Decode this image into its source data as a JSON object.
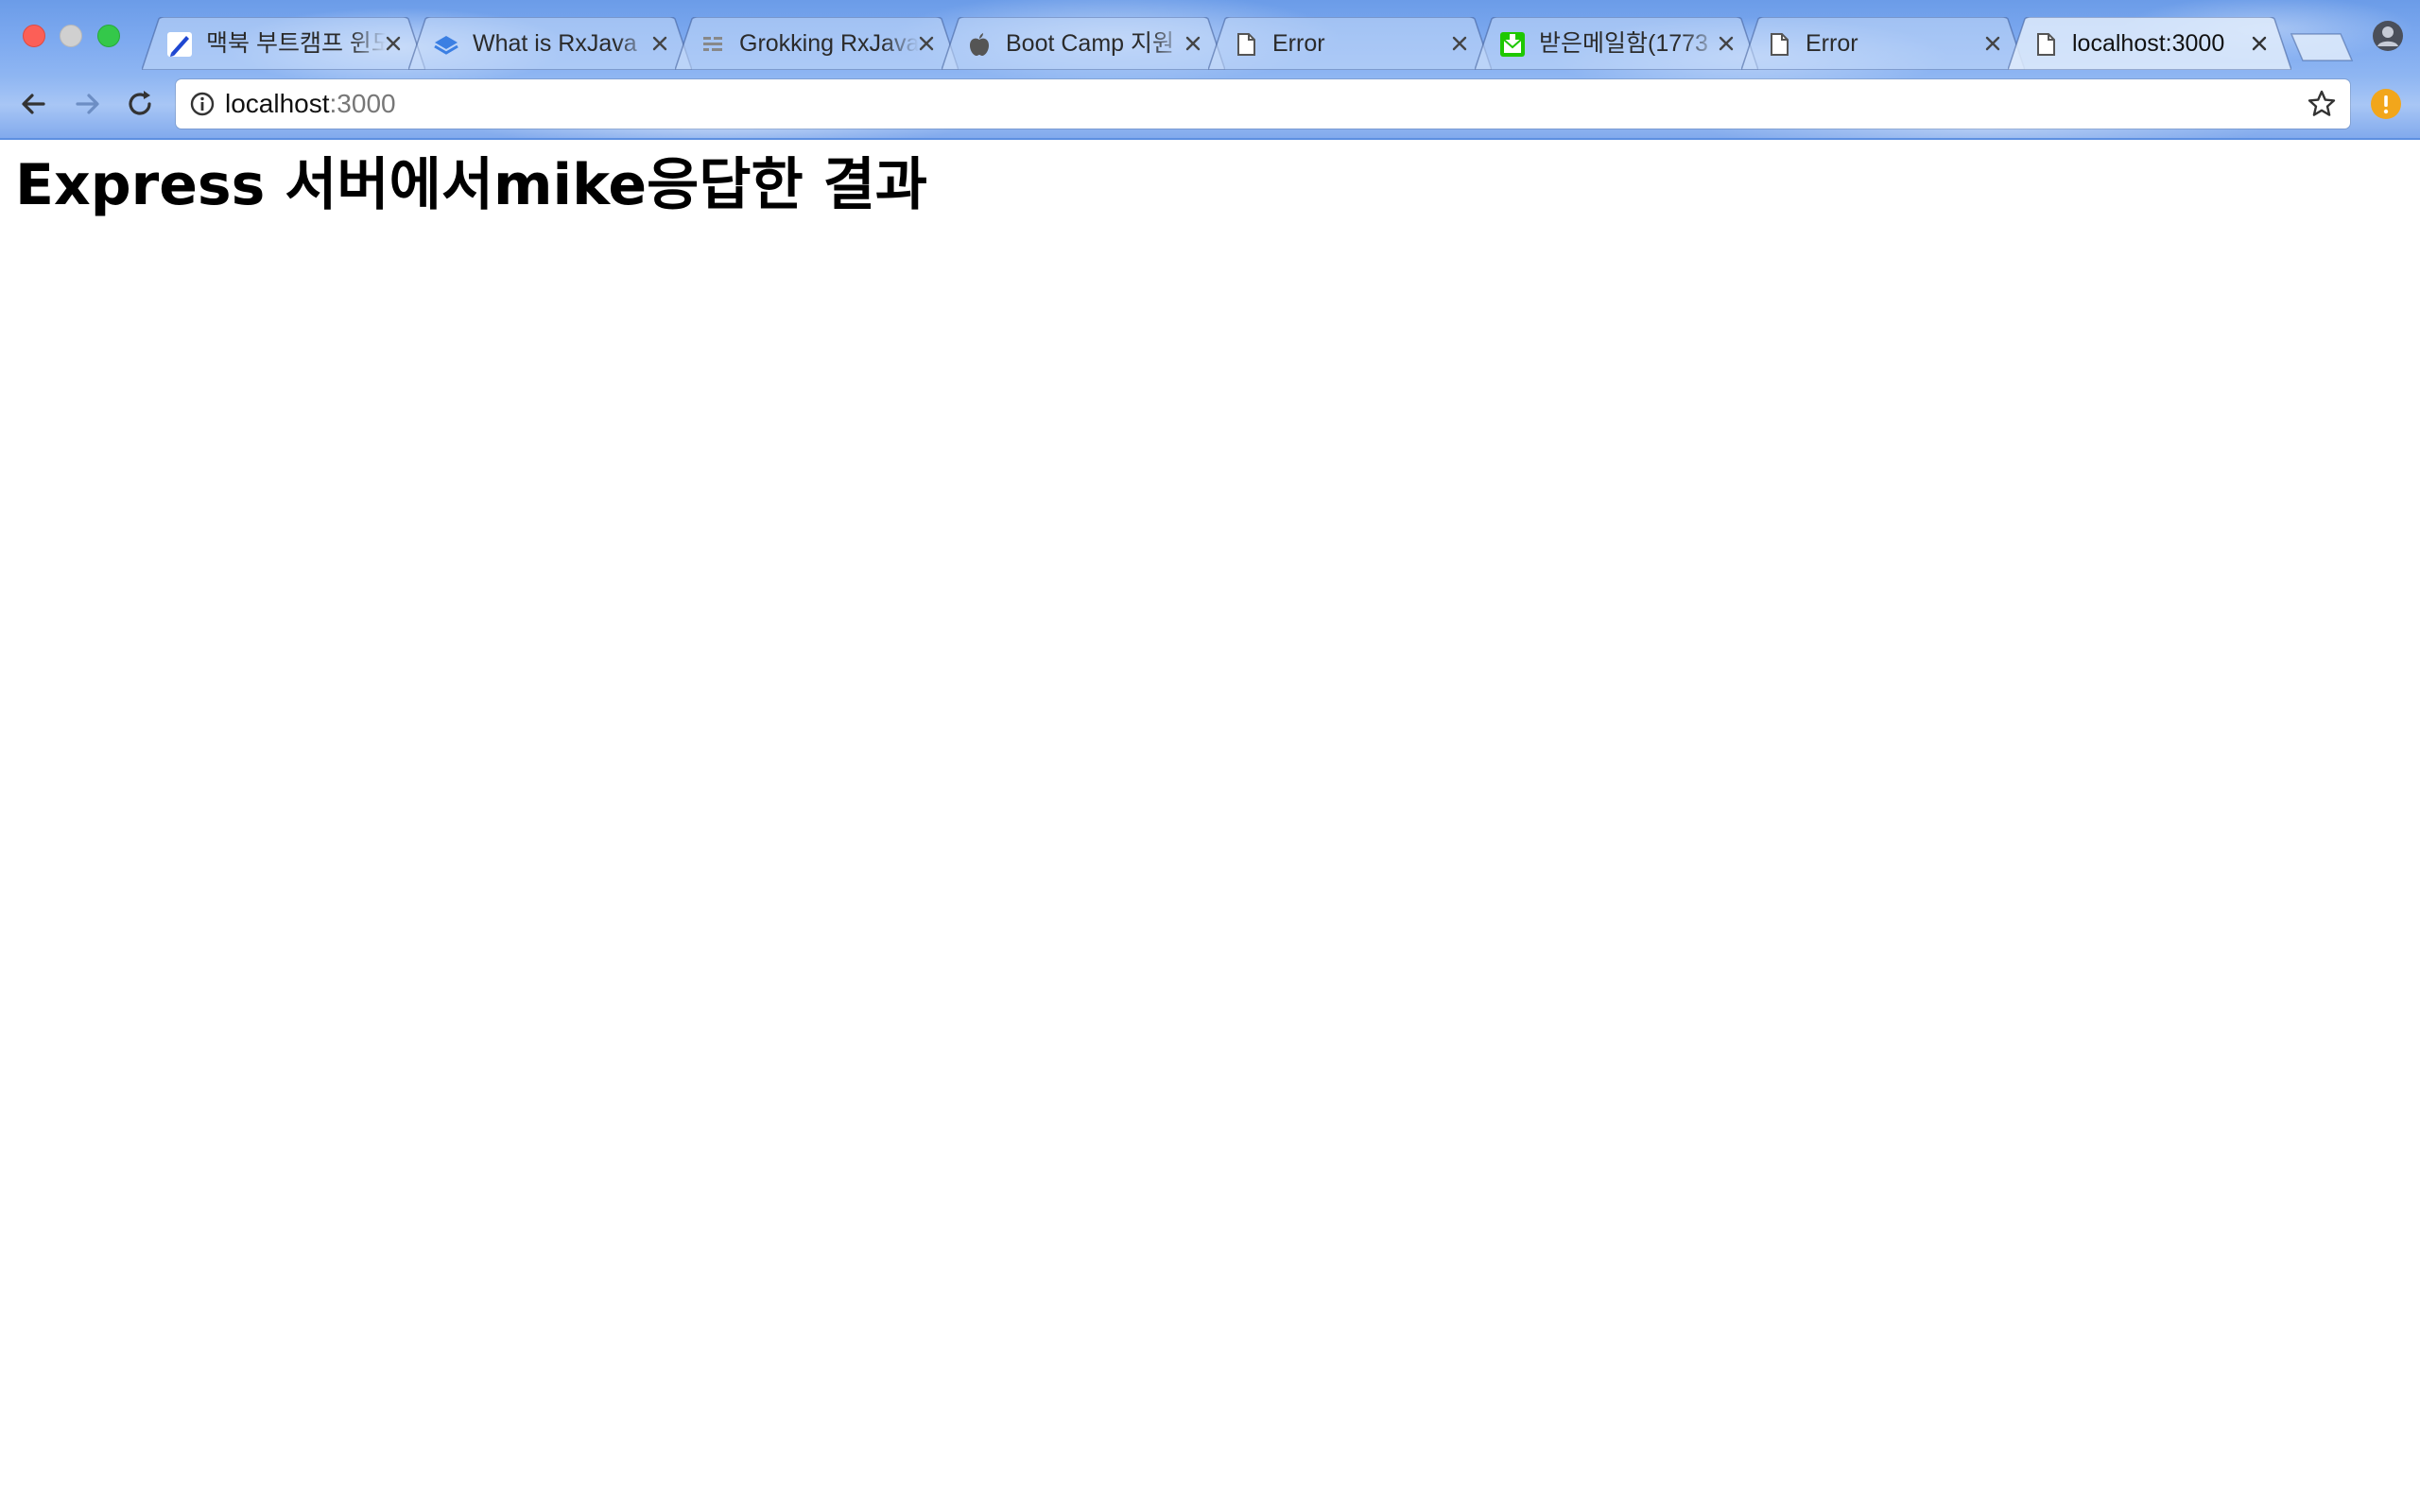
{
  "browser": {
    "tabs": [
      {
        "title": "맥북 부트캠프 윈도",
        "favicon": "pencil-icon",
        "active": false
      },
      {
        "title": "What is RxJava",
        "favicon": "book-stack-icon",
        "active": false
      },
      {
        "title": "Grokking RxJava",
        "favicon": "list-lines-icon",
        "active": false
      },
      {
        "title": "Boot Camp 지원",
        "favicon": "apple-icon",
        "active": false
      },
      {
        "title": "Error",
        "favicon": "document-icon",
        "active": false
      },
      {
        "title": "받은메일함(1773",
        "favicon": "mail-icon",
        "active": false
      },
      {
        "title": "Error",
        "favicon": "document-icon",
        "active": false
      },
      {
        "title": "localhost:3000",
        "favicon": "document-icon",
        "active": true
      }
    ],
    "address_bar": {
      "host": "localhost",
      "port": ":3000"
    },
    "colors": {
      "close": "#fc5f57",
      "minimize": "#d0d0d0",
      "maximize": "#34c84a",
      "alert": "#f2a61b"
    }
  },
  "page": {
    "heading": "Express 서버에서mike응답한 결과"
  }
}
